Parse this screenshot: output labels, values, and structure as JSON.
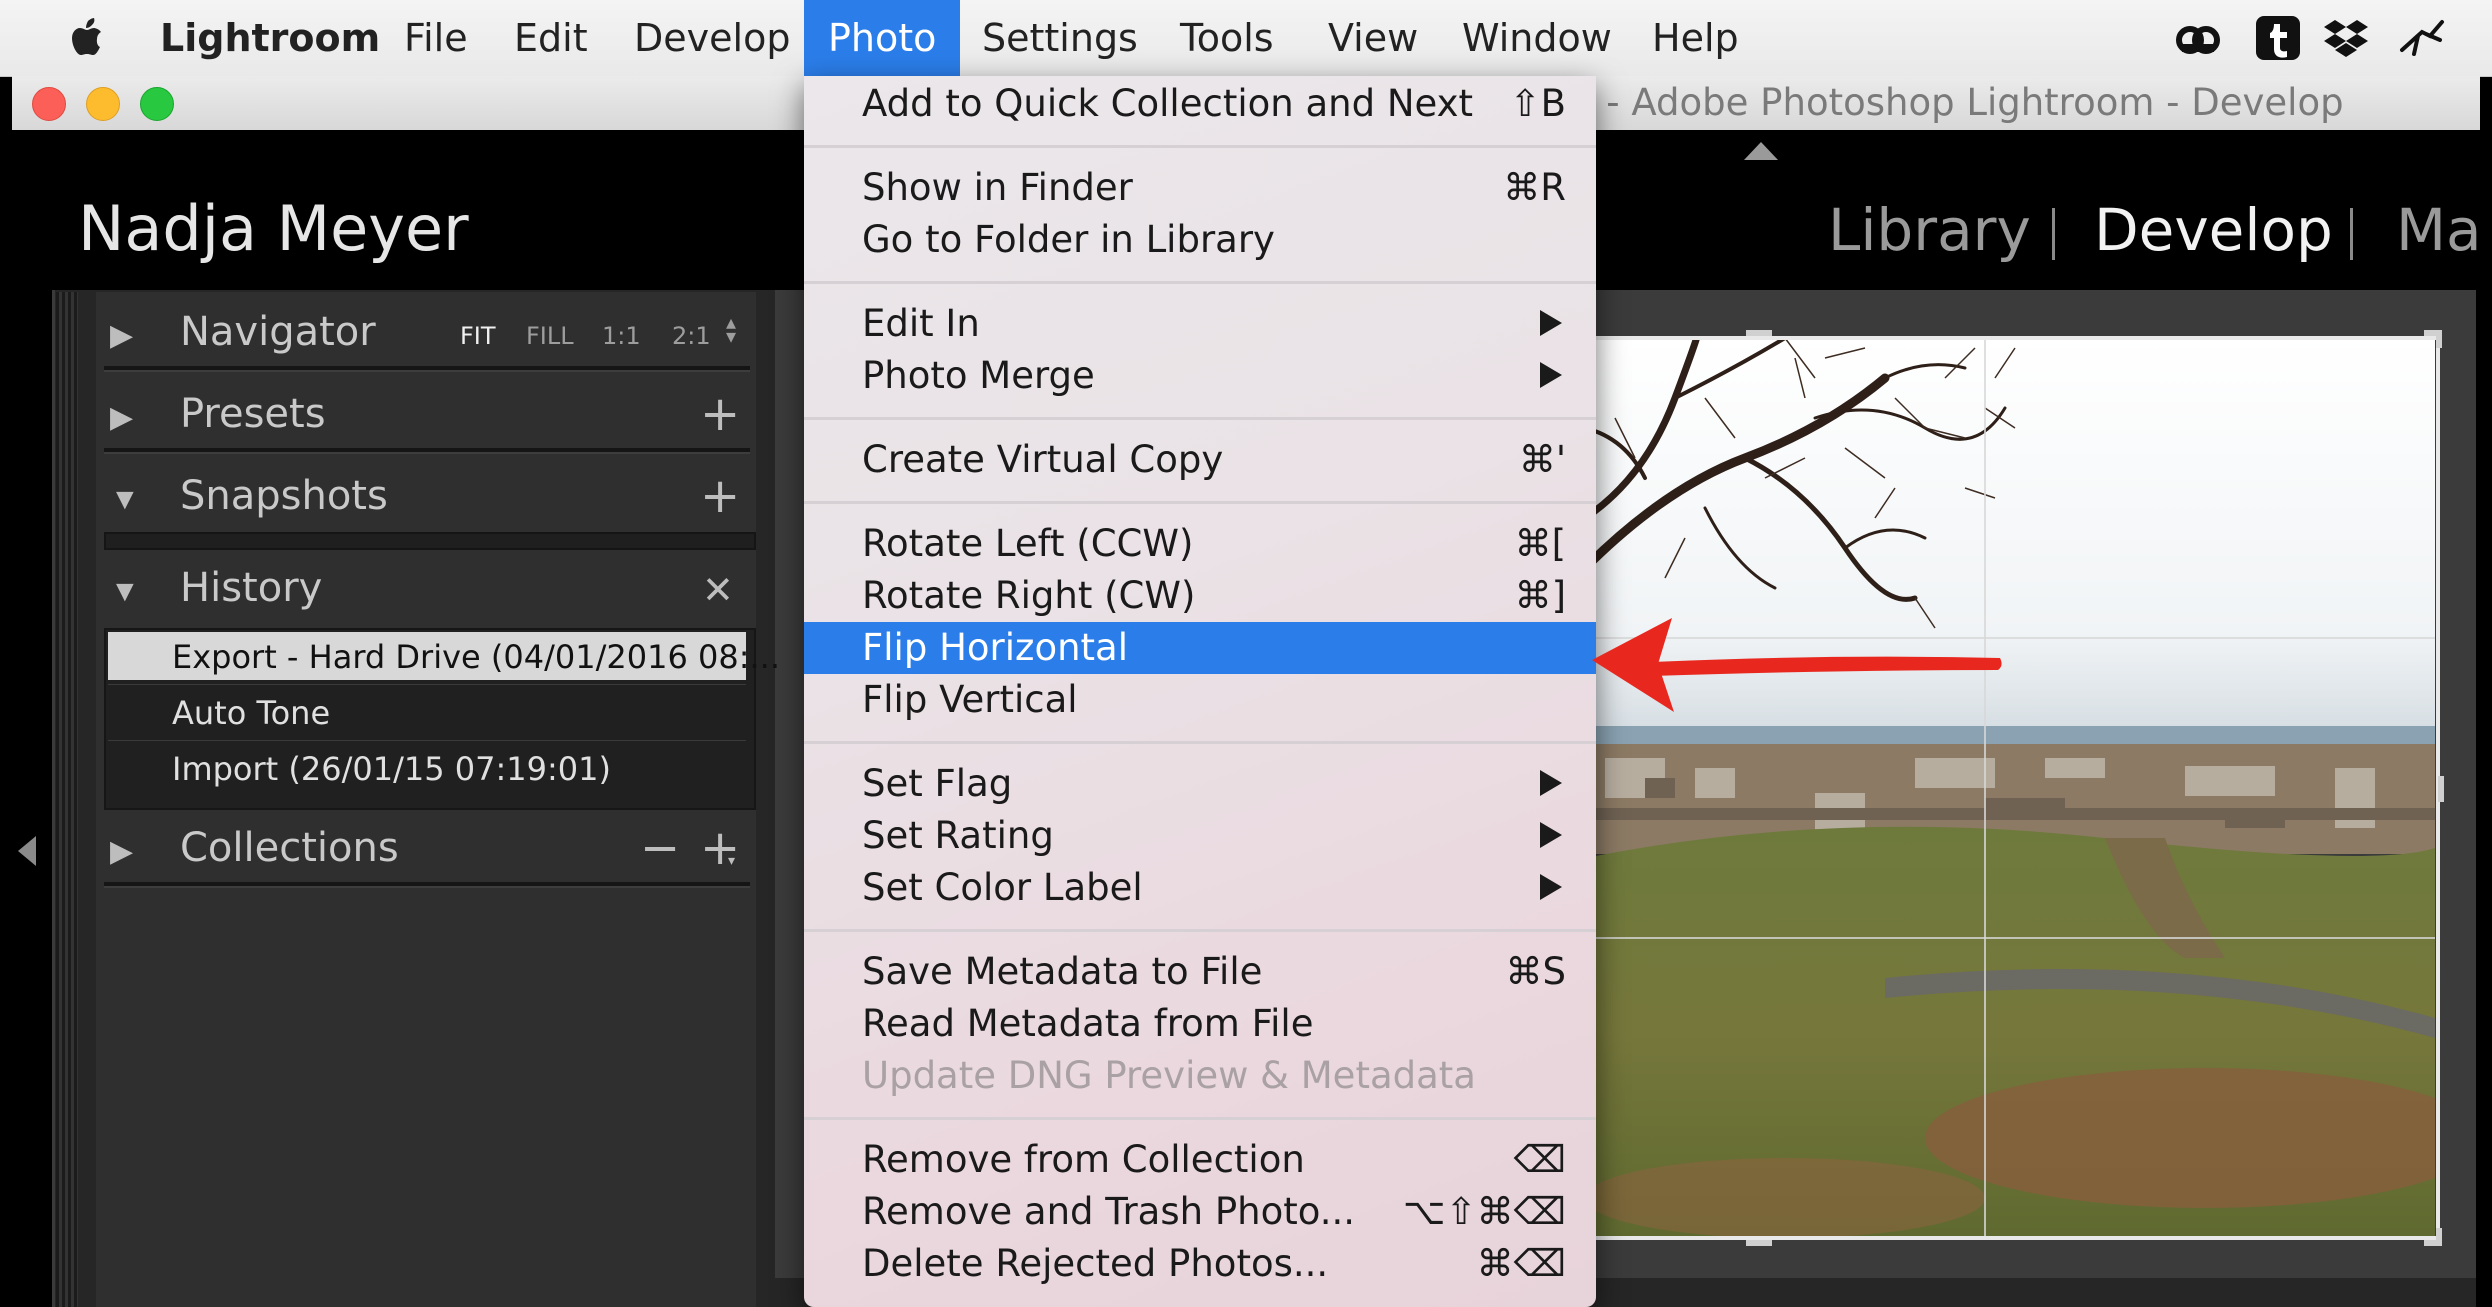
{
  "menubar": {
    "app_name": "Lightroom",
    "items": [
      "File",
      "Edit",
      "Develop",
      "Photo",
      "Settings",
      "Tools",
      "View",
      "Window",
      "Help"
    ],
    "active_item": "Photo",
    "tray_icons": [
      "creative-cloud-icon",
      "tumblr-icon",
      "dropbox-icon",
      "cursor-tool-icon"
    ]
  },
  "window": {
    "title_visible": "t - Adobe Photoshop Lightroom - Develop"
  },
  "header": {
    "identity_plate": "Nadja Meyer",
    "modules": [
      "Library",
      "Develop",
      "Ma"
    ],
    "active_module": "Develop"
  },
  "left_panel": {
    "navigator": {
      "label": "Navigator",
      "zoom_options": [
        "FIT",
        "FILL",
        "1:1",
        "2:1"
      ],
      "active_zoom": "FIT"
    },
    "presets": {
      "label": "Presets"
    },
    "snapshots": {
      "label": "Snapshots"
    },
    "history": {
      "label": "History",
      "items": [
        "Export - Hard Drive (04/01/2016 08:...",
        "Auto Tone",
        "Import (26/01/15 07:19:01)"
      ],
      "selected_index": 0
    },
    "collections": {
      "label": "Collections"
    }
  },
  "photo_menu": {
    "items": [
      {
        "label": "Add to Quick Collection and Next",
        "shortcut": "⇧B"
      },
      {
        "label": "Show in Finder",
        "shortcut": "⌘R"
      },
      {
        "label": "Go to Folder in Library",
        "shortcut": ""
      },
      {
        "label": "Edit In",
        "shortcut": ""
      },
      {
        "label": "Photo Merge",
        "shortcut": ""
      },
      {
        "label": "Create Virtual Copy",
        "shortcut": "⌘'"
      },
      {
        "label": "Rotate Left (CCW)",
        "shortcut": "⌘["
      },
      {
        "label": "Rotate Right (CW)",
        "shortcut": "⌘]"
      },
      {
        "label": "Flip Horizontal",
        "shortcut": ""
      },
      {
        "label": "Flip Vertical",
        "shortcut": ""
      },
      {
        "label": "Set Flag",
        "shortcut": ""
      },
      {
        "label": "Set Rating",
        "shortcut": ""
      },
      {
        "label": "Set Color Label",
        "shortcut": ""
      },
      {
        "label": "Save Metadata to File",
        "shortcut": "⌘S"
      },
      {
        "label": "Read Metadata from File",
        "shortcut": ""
      },
      {
        "label": "Update DNG Preview & Metadata",
        "shortcut": ""
      },
      {
        "label": "Remove from Collection",
        "shortcut": "⌫"
      },
      {
        "label": "Remove and Trash Photo...",
        "shortcut": "⌥⇧⌘⌫"
      },
      {
        "label": "Delete Rejected Photos...",
        "shortcut": "⌘⌫"
      }
    ],
    "highlighted": "Flip Horizontal",
    "disabled": [
      "Update DNG Preview & Metadata"
    ],
    "submenus": [
      "Edit In",
      "Photo Merge",
      "Set Flag",
      "Set Rating",
      "Set Color Label"
    ]
  },
  "colors": {
    "menu_highlight": "#2b7de9",
    "annotation_arrow": "#e8281e",
    "panel_bg": "#2f2f2f"
  }
}
